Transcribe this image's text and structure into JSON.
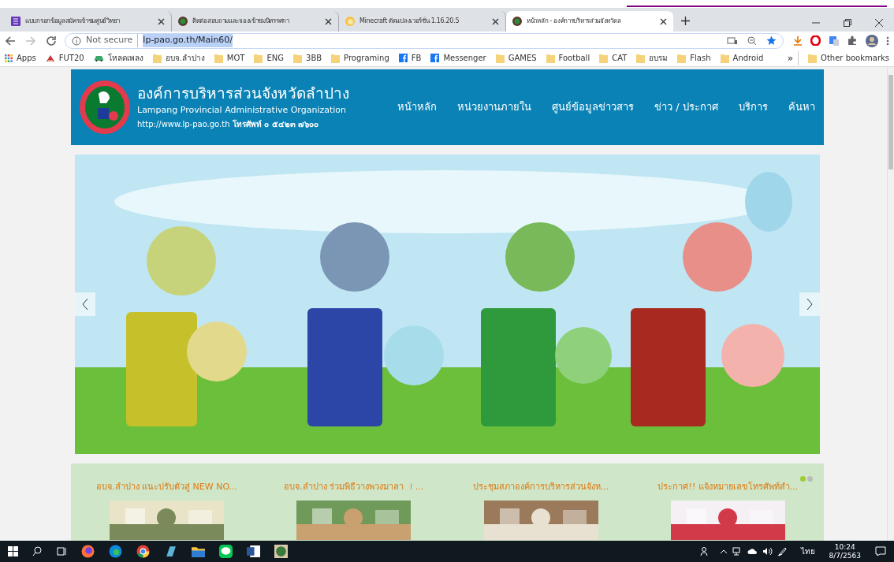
{
  "tabs": [
    {
      "title": "แบบกรอกข้อมูลสมัครเข้าชมศูนย์วิทยา",
      "selected": false
    },
    {
      "title": "ติดต่อสอบถามและจองเข้าชมนิทรรศกา",
      "selected": false
    },
    {
      "title": "Minecraft ดัดแปลงเวอร์ชั่น 1.16.20.5",
      "selected": false
    },
    {
      "title": "หน้าหลัก - องค์การบริหารส่วนจังหวัดล",
      "selected": true
    }
  ],
  "address_bar": {
    "security": "Not secure",
    "url": "lp-pao.go.th/Main60/"
  },
  "bookmarks": [
    {
      "label": "Apps",
      "kind": "apps"
    },
    {
      "label": "FUT20",
      "kind": "site"
    },
    {
      "label": "โหลดเพลง",
      "kind": "car"
    },
    {
      "label": "อบจ.ลำปาง",
      "kind": "folder"
    },
    {
      "label": "MOT",
      "kind": "folder"
    },
    {
      "label": "ENG",
      "kind": "folder"
    },
    {
      "label": "3BB",
      "kind": "folder"
    },
    {
      "label": "Programing",
      "kind": "folder"
    },
    {
      "label": "FB",
      "kind": "facebook"
    },
    {
      "label": "Messenger",
      "kind": "facebook"
    },
    {
      "label": "GAMES",
      "kind": "folder"
    },
    {
      "label": "Football",
      "kind": "folder"
    },
    {
      "label": "CAT",
      "kind": "folder"
    },
    {
      "label": "อบรม",
      "kind": "folder"
    },
    {
      "label": "Flash",
      "kind": "folder"
    },
    {
      "label": "Android",
      "kind": "folder"
    }
  ],
  "bookmarks_overflow": "»",
  "other_bookmarks": "Other bookmarks",
  "site_header": {
    "title": "องค์การบริหารส่วนจังหวัดลำปาง",
    "subtitle": "Lampang Provincial Administrative Organization",
    "contact": "http://www.lp-pao.go.th **โทรศัพท์ ๐ ๕๔๒๓ ๗๖๐๐**"
  },
  "nav": [
    "หน้าหลัก",
    "หน่วยงานภายใน",
    "ศูนย์ข้อมูลข่าวสาร",
    "ข่าว / ประกาศ",
    "บริการ",
    "ค้นหา"
  ],
  "news": [
    {
      "title": "อบจ.ลำปาง แนะปรับตัวสู่ NEW NO..."
    },
    {
      "title": "อบจ.ลำปาง ร่วมพิธีวางพวงมาลา ｌ..."
    },
    {
      "title": "ประชุมสภาองค์การบริหารส่วนจังห..."
    },
    {
      "title": "ประกาศ!! แจ้งหมายเลขโทรศัพท์สำ..."
    }
  ],
  "news_dots": [
    {
      "selected": true
    },
    {
      "selected": false
    }
  ],
  "taskbar": {
    "language": "ไทย",
    "time": "10:24",
    "date": "8/7/2563"
  }
}
